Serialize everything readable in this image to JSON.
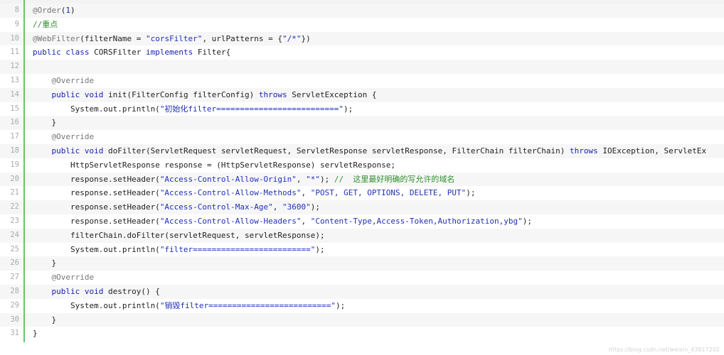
{
  "editor": {
    "lines": [
      {
        "n": "8",
        "tokens": [
          [
            "ann",
            "@Order"
          ],
          [
            "plain",
            "("
          ],
          [
            "num",
            "1"
          ],
          [
            "plain",
            ")"
          ]
        ]
      },
      {
        "n": "9",
        "tokens": [
          [
            "com",
            "//重点"
          ]
        ]
      },
      {
        "n": "10",
        "tokens": [
          [
            "ann",
            "@WebFilter"
          ],
          [
            "plain",
            "(filterName = "
          ],
          [
            "str",
            "\"corsFilter\""
          ],
          [
            "plain",
            ", urlPatterns = {"
          ],
          [
            "str",
            "\"/*\""
          ],
          [
            "plain",
            "})"
          ]
        ]
      },
      {
        "n": "11",
        "tokens": [
          [
            "kw",
            "public"
          ],
          [
            "plain",
            " "
          ],
          [
            "kw",
            "class"
          ],
          [
            "plain",
            " CORSFilter "
          ],
          [
            "kw",
            "implements"
          ],
          [
            "plain",
            " Filter{"
          ]
        ]
      },
      {
        "n": "12",
        "tokens": []
      },
      {
        "n": "13",
        "tokens": [
          [
            "plain",
            "    "
          ],
          [
            "ann",
            "@Override"
          ]
        ]
      },
      {
        "n": "14",
        "tokens": [
          [
            "plain",
            "    "
          ],
          [
            "kw",
            "public"
          ],
          [
            "plain",
            " "
          ],
          [
            "kw",
            "void"
          ],
          [
            "plain",
            " init(FilterConfig filterConfig) "
          ],
          [
            "kw",
            "throws"
          ],
          [
            "plain",
            " ServletException {"
          ]
        ]
      },
      {
        "n": "15",
        "tokens": [
          [
            "plain",
            "        System.out.println("
          ],
          [
            "str",
            "\"初始化filter==========================\""
          ],
          [
            "plain",
            ");"
          ]
        ]
      },
      {
        "n": "16",
        "tokens": [
          [
            "plain",
            "    }"
          ]
        ]
      },
      {
        "n": "17",
        "tokens": [
          [
            "plain",
            "    "
          ],
          [
            "ann",
            "@Override"
          ]
        ]
      },
      {
        "n": "18",
        "tokens": [
          [
            "plain",
            "    "
          ],
          [
            "kw",
            "public"
          ],
          [
            "plain",
            " "
          ],
          [
            "kw",
            "void"
          ],
          [
            "plain",
            " doFilter(ServletRequest servletRequest, ServletResponse servletResponse, FilterChain filterChain) "
          ],
          [
            "kw",
            "throws"
          ],
          [
            "plain",
            " IOException, ServletEx"
          ]
        ]
      },
      {
        "n": "19",
        "tokens": [
          [
            "plain",
            "        HttpServletResponse response = (HttpServletResponse) servletResponse;"
          ]
        ]
      },
      {
        "n": "20",
        "tokens": [
          [
            "plain",
            "        response.setHeader("
          ],
          [
            "str",
            "\"Access-Control-Allow-Origin\""
          ],
          [
            "plain",
            ", "
          ],
          [
            "str",
            "\"*\""
          ],
          [
            "plain",
            "); "
          ],
          [
            "com",
            "//  这里最好明确的写允许的域名"
          ]
        ]
      },
      {
        "n": "21",
        "tokens": [
          [
            "plain",
            "        response.setHeader("
          ],
          [
            "str",
            "\"Access-Control-Allow-Methods\""
          ],
          [
            "plain",
            ", "
          ],
          [
            "str",
            "\"POST, GET, OPTIONS, DELETE, PUT\""
          ],
          [
            "plain",
            ");"
          ]
        ]
      },
      {
        "n": "22",
        "tokens": [
          [
            "plain",
            "        response.setHeader("
          ],
          [
            "str",
            "\"Access-Control-Max-Age\""
          ],
          [
            "plain",
            ", "
          ],
          [
            "str",
            "\"3600\""
          ],
          [
            "plain",
            ");"
          ]
        ]
      },
      {
        "n": "23",
        "tokens": [
          [
            "plain",
            "        response.setHeader("
          ],
          [
            "str",
            "\"Access-Control-Allow-Headers\""
          ],
          [
            "plain",
            ", "
          ],
          [
            "str",
            "\"Content-Type,Access-Token,Authorization,ybg\""
          ],
          [
            "plain",
            ");"
          ]
        ]
      },
      {
        "n": "24",
        "tokens": [
          [
            "plain",
            "        filterChain.doFilter(servletRequest, servletResponse);"
          ]
        ]
      },
      {
        "n": "25",
        "tokens": [
          [
            "plain",
            "        System.out.println("
          ],
          [
            "str",
            "\"filter=========================\""
          ],
          [
            "plain",
            ");"
          ]
        ]
      },
      {
        "n": "26",
        "tokens": [
          [
            "plain",
            "    }"
          ]
        ]
      },
      {
        "n": "27",
        "tokens": [
          [
            "plain",
            "    "
          ],
          [
            "ann",
            "@Override"
          ]
        ]
      },
      {
        "n": "28",
        "tokens": [
          [
            "plain",
            "    "
          ],
          [
            "kw",
            "public"
          ],
          [
            "plain",
            " "
          ],
          [
            "kw",
            "void"
          ],
          [
            "plain",
            " destroy() {"
          ]
        ]
      },
      {
        "n": "29",
        "tokens": [
          [
            "plain",
            "        System.out.println("
          ],
          [
            "str",
            "\"销毁filter==========================\""
          ],
          [
            "plain",
            ");"
          ]
        ]
      },
      {
        "n": "30",
        "tokens": [
          [
            "plain",
            "    }"
          ]
        ]
      },
      {
        "n": "31",
        "tokens": [
          [
            "plain",
            "}"
          ]
        ]
      }
    ]
  },
  "watermark": "https://blog.csdn.net/weixin_43817202"
}
